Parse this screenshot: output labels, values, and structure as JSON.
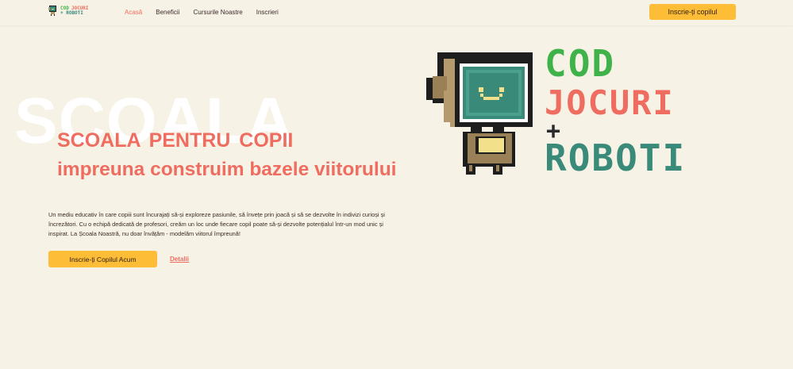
{
  "nav": {
    "logo": {
      "line1_a": "COD",
      "line1_b": "JOCURI",
      "line2": "+ ROBOTI"
    },
    "links": [
      {
        "label": "Acasă",
        "active": true
      },
      {
        "label": "Beneficii",
        "active": false
      },
      {
        "label": "Cursurile Noastre",
        "active": false
      },
      {
        "label": "Inscrieri",
        "active": false
      }
    ],
    "cta_label": "Inscrie-ți copilul"
  },
  "hero": {
    "background_word": "SCOALA",
    "title": "SCOALA PENTRU COPII",
    "subtitle": "impreuna construim bazele viitorului",
    "description": "Un mediu educativ în care copiii sunt încurajați să-și exploreze pasiunile, să învețe prin joacă și să se dezvolte în indivizi curioși și încrezători. Cu o echipă dedicată de profesori, creăm un loc unde fiecare copil poate să-și dezvolte potențialul într-un mod unic și inspirat. La Școala Noastră, nu doar învățăm - modelăm viitorul împreună!",
    "cta_label": "Inscrie-ți Copilul Acum",
    "details_label": "Detalii"
  },
  "big_logo": {
    "line1": "COD",
    "line2": "JOCURI",
    "line3": "+",
    "line4": "ROBOTI"
  },
  "colors": {
    "background": "#f7f2e6",
    "accent_coral": "#ef6d60",
    "accent_yellow": "#fdbd36",
    "green": "#3fb34a",
    "teal": "#3a8a7a"
  },
  "icons": {
    "logo_robot": "pixel-robot-icon"
  }
}
